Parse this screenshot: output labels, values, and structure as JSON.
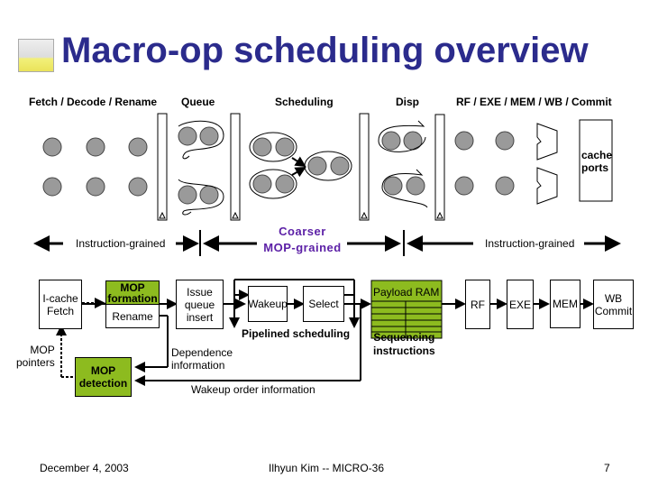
{
  "slide": {
    "title": "Macro-op scheduling overview",
    "logo_icon": "landscape-logo-icon"
  },
  "pipeline_stages": {
    "fetch": "Fetch / Decode / Rename",
    "queue": "Queue",
    "scheduling": "Scheduling",
    "disp": "Disp",
    "backend": "RF / EXE / MEM / WB / Commit"
  },
  "cache_ports_label": [
    "cache",
    "ports"
  ],
  "granularity": {
    "left": "Instruction-grained",
    "middle_line1": "Coarser",
    "middle_line2": "MOP-grained",
    "right": "Instruction-grained"
  },
  "blocks": {
    "icache": [
      "I-cache",
      "Fetch"
    ],
    "mop_formation": [
      "MOP",
      "formation"
    ],
    "rename": "Rename",
    "issue_queue": [
      "Issue",
      "queue",
      "insert"
    ],
    "wakeup": "Wakeup",
    "select": "Select",
    "payload_ram": "Payload RAM",
    "rf": "RF",
    "exe": "EXE",
    "mem": "MEM",
    "wb_commit": [
      "WB",
      "Commit"
    ],
    "mop_detection": [
      "MOP",
      "detection"
    ]
  },
  "annotations": {
    "pipelined_scheduling": "Pipelined scheduling",
    "sequencing": [
      "Sequencing",
      "instructions"
    ],
    "mop_pointers": [
      "MOP",
      "pointers"
    ],
    "dependence": [
      "Dependence",
      "information"
    ],
    "wakeup_order": "Wakeup order information"
  },
  "footer": {
    "date": "December 4, 2003",
    "author": "Ilhyun Kim -- MICRO-36",
    "page": "7"
  },
  "colors": {
    "title": "#2b2b8c",
    "green": "#8dbb1f",
    "node_fill": "#9a9a9a",
    "purple": "#5b1fa6"
  }
}
